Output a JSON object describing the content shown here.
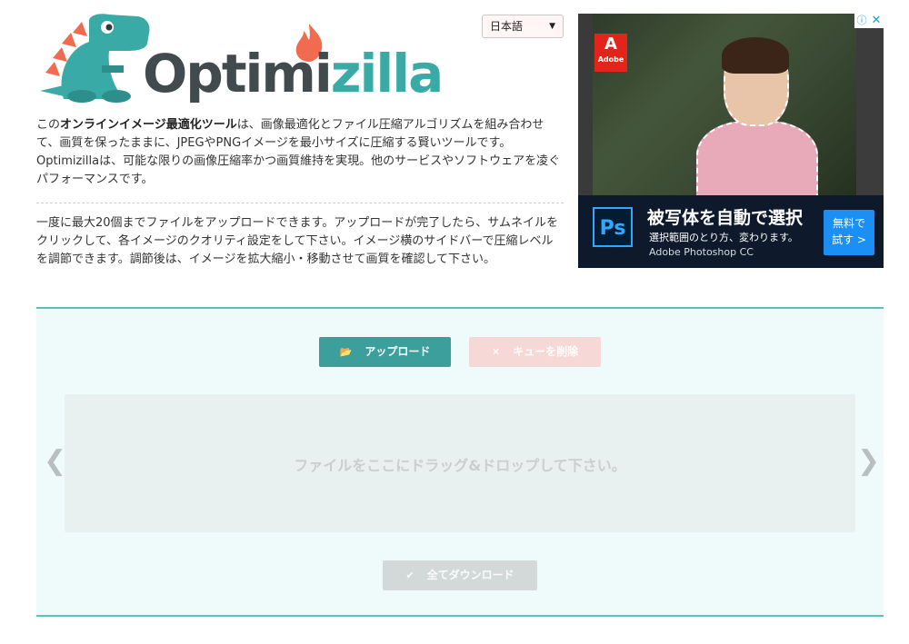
{
  "logo": {
    "text_dark": "Optimi",
    "text_teal": "zilla",
    "mascot": "dinosaur-icon",
    "flame": "flame-icon",
    "colors": {
      "dark": "#414b4e",
      "teal": "#3aaaa6",
      "flame": "#f06b4f"
    }
  },
  "language_select": {
    "value": "日本語",
    "chevron": "chevron-down-icon"
  },
  "intro": {
    "pre": "この",
    "bold": "オンラインイメージ最適化ツール",
    "post": "は、画像最適化とファイル圧縮アルゴリズムを組み合わせて、画質を保ったままに、JPEGやPNGイメージを最小サイズに圧縮する賢いツールです。Optimizillaは、可能な限りの画像圧縮率かつ画質維持を実現。他のサービスやソフトウェアを凌ぐパフォーマンスです。"
  },
  "howto": "一度に最大20個までファイルをアップロードできます。アップロードが完了したら、サムネイルをクリックして、各イメージのクオリティ設定をして下さい。イメージ横のサイドバーで圧縮レベルを調節できます。調節後は、イメージを拡大縮小・移動させて画質を確認して下さい。",
  "ad": {
    "headline": "被写体を自動で選択",
    "subline": "選択範囲のとり方、変わります。",
    "brand": "Adobe Photoshop CC",
    "ps_logo": "Ps",
    "adobe_tag": "Adobe",
    "cta_line1": "無料で",
    "cta_line2": "試す >",
    "adchoices_icon": "info-icon",
    "close_icon": "close-icon"
  },
  "uploader": {
    "upload_label": "アップロード",
    "upload_icon": "folder-open-icon",
    "clear_label": "キューを削除",
    "clear_icon": "close-icon",
    "dropzone_text": "ファイルをここにドラッグ&ドロップして下さい。",
    "download_label": "全てダウンロード",
    "download_icon": "check-icon",
    "prev_arrow": "❮",
    "next_arrow": "❯",
    "colors": {
      "accent": "#3c9f9c",
      "area_bg": "#effbfa",
      "border": "#5fbfbb"
    }
  }
}
